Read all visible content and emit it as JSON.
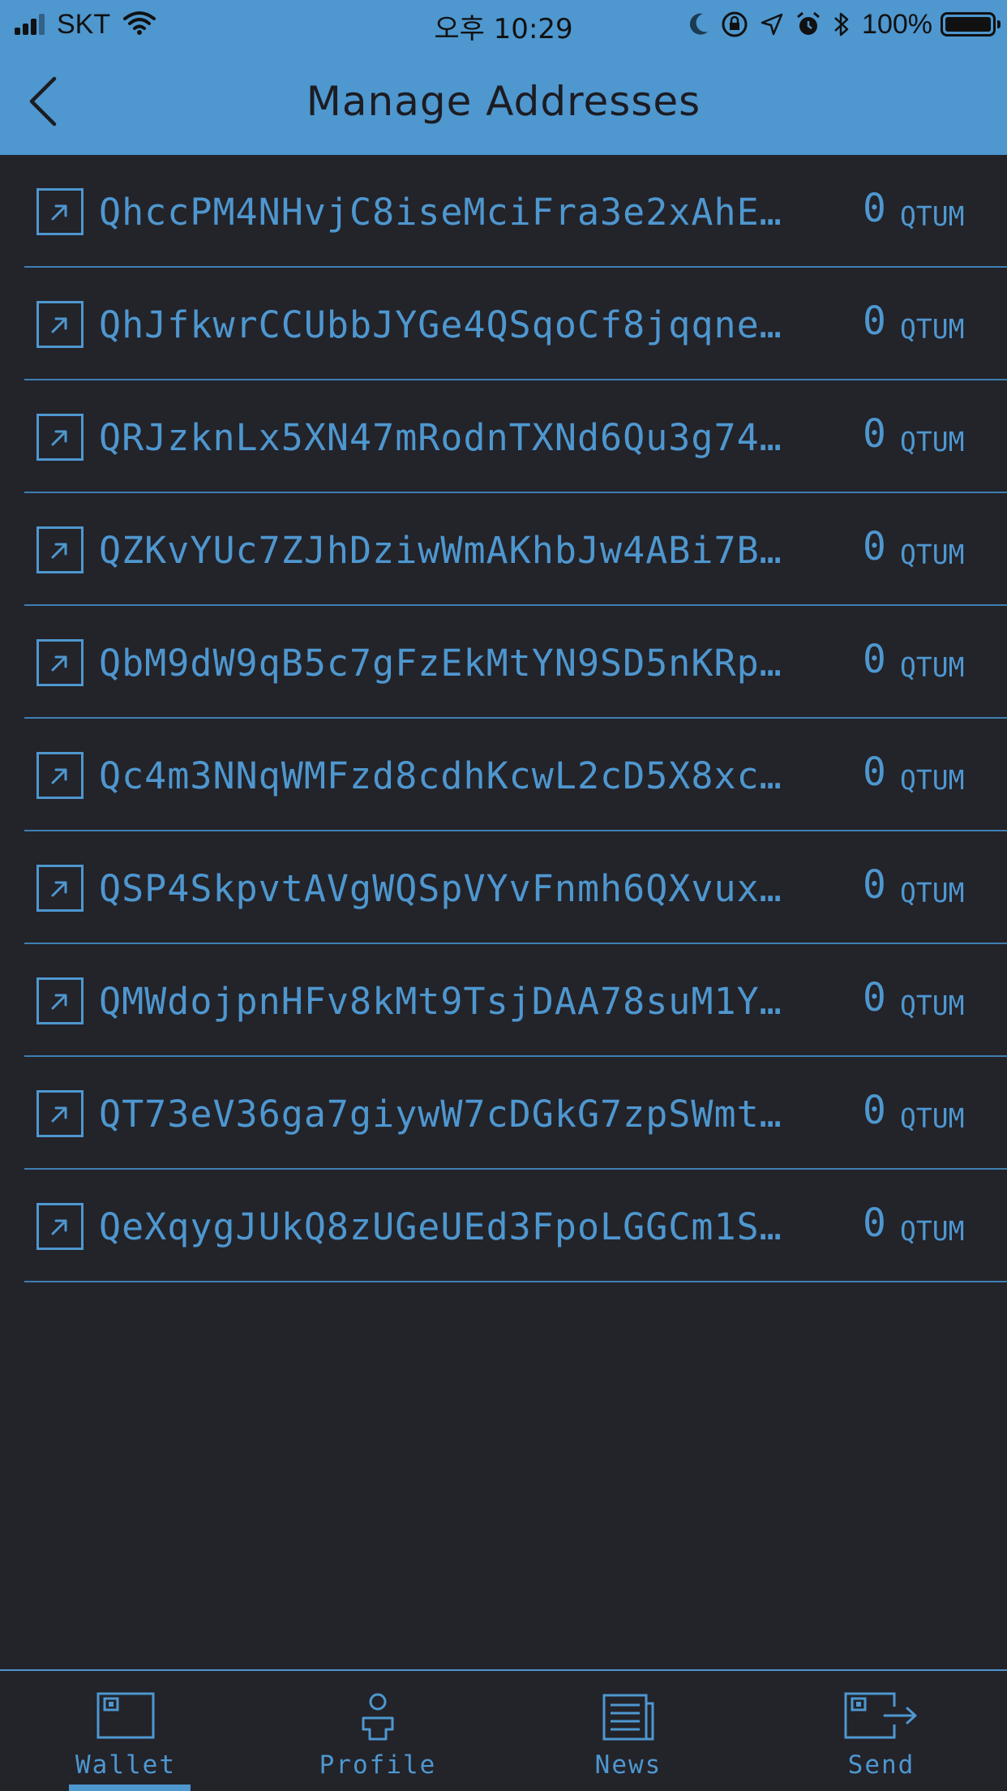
{
  "status_bar": {
    "carrier": "SKT",
    "time": "오후 10:29",
    "battery": "100%",
    "icons": [
      "signal-icon",
      "wifi-icon",
      "moon-icon",
      "rotation-lock-icon",
      "location-icon",
      "alarm-icon",
      "bluetooth-icon",
      "battery-icon"
    ]
  },
  "header": {
    "title": "Manage Addresses",
    "back_icon": "chevron-left-icon"
  },
  "addresses": [
    {
      "address": "QhccPM4NHvjC8iseMciFra3e2xAhE…",
      "amount": "0",
      "unit": "QTUM"
    },
    {
      "address": "QhJfkwrCCUbbJYGe4QSqoCf8jqqne…",
      "amount": "0",
      "unit": "QTUM"
    },
    {
      "address": "QRJzknLx5XN47mRodnTXNd6Qu3g74…",
      "amount": "0",
      "unit": "QTUM"
    },
    {
      "address": "QZKvYUc7ZJhDziwWmAKhbJw4ABi7B…",
      "amount": "0",
      "unit": "QTUM"
    },
    {
      "address": "QbM9dW9qB5c7gFzEkMtYN9SD5nKRp…",
      "amount": "0",
      "unit": "QTUM"
    },
    {
      "address": "Qc4m3NNqWMFzd8cdhKcwL2cD5X8xc…",
      "amount": "0",
      "unit": "QTUM"
    },
    {
      "address": "QSP4SkpvtAVgWQSpVYvFnmh6QXvux…",
      "amount": "0",
      "unit": "QTUM"
    },
    {
      "address": "QMWdojpnHFv8kMt9TsjDAA78suM1Y…",
      "amount": "0",
      "unit": "QTUM"
    },
    {
      "address": "QT73eV36ga7giywW7cDGkG7zpSWmt…",
      "amount": "0",
      "unit": "QTUM"
    },
    {
      "address": "QeXqygJUkQ8zUGeUEd3FpoLGGCm1S…",
      "amount": "0",
      "unit": "QTUM"
    }
  ],
  "tabbar": {
    "tabs": [
      {
        "label": "Wallet",
        "icon": "wallet-icon",
        "active": true
      },
      {
        "label": "Profile",
        "icon": "profile-icon",
        "active": false
      },
      {
        "label": "News",
        "icon": "news-icon",
        "active": false
      },
      {
        "label": "Send",
        "icon": "send-icon",
        "active": false
      }
    ]
  },
  "colors": {
    "accent": "#4e97cf",
    "background": "#23232a",
    "title_text": "#1c1c22"
  }
}
